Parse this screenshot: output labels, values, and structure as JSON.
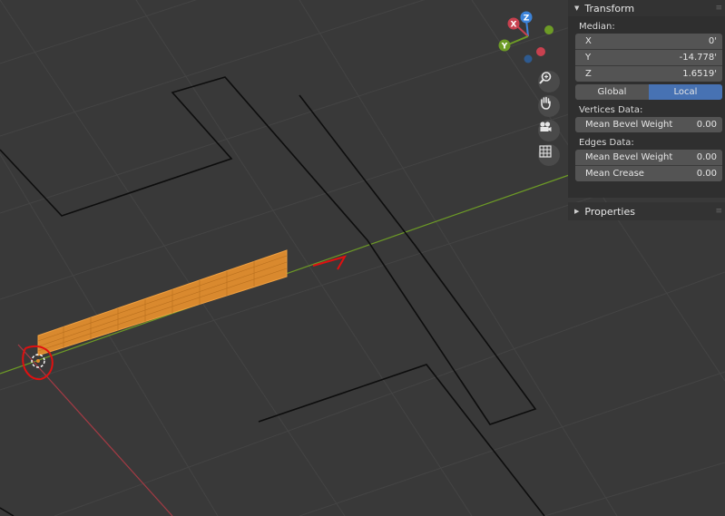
{
  "transform": {
    "title": "Transform",
    "median_label": "Median:",
    "fields": [
      {
        "label": "X",
        "value": "0'"
      },
      {
        "label": "Y",
        "value": "-14.778'"
      },
      {
        "label": "Z",
        "value": "1.6519'"
      }
    ],
    "space_toggle": {
      "global": "Global",
      "local": "Local",
      "selected": "Local"
    }
  },
  "vertices_data": {
    "label": "Vertices Data:",
    "mean_bevel_weight_label": "Mean Bevel Weight",
    "mean_bevel_weight_value": "0.00"
  },
  "edges_data": {
    "label": "Edges Data:",
    "mean_bevel_weight_label": "Mean Bevel Weight",
    "mean_bevel_weight_value": "0.00",
    "mean_crease_label": "Mean Crease",
    "mean_crease_value": "0.00"
  },
  "properties": {
    "title": "Properties"
  },
  "gizmo": {
    "x_label": "X",
    "y_label": "Y",
    "z_label": "Z"
  },
  "colors": {
    "background": "#393939",
    "x_axis": "#c8414f",
    "y_axis": "#6d9b26",
    "z_axis": "#3c83d9",
    "mesh": "#e08a2a",
    "accent": "#4772b3",
    "annotation": "#e01010"
  },
  "icons": [
    "zoom-icon",
    "hand-pan-icon",
    "camera-icon",
    "grid-view-icon",
    "triangle-expanded-icon",
    "triangle-collapsed-icon"
  ]
}
